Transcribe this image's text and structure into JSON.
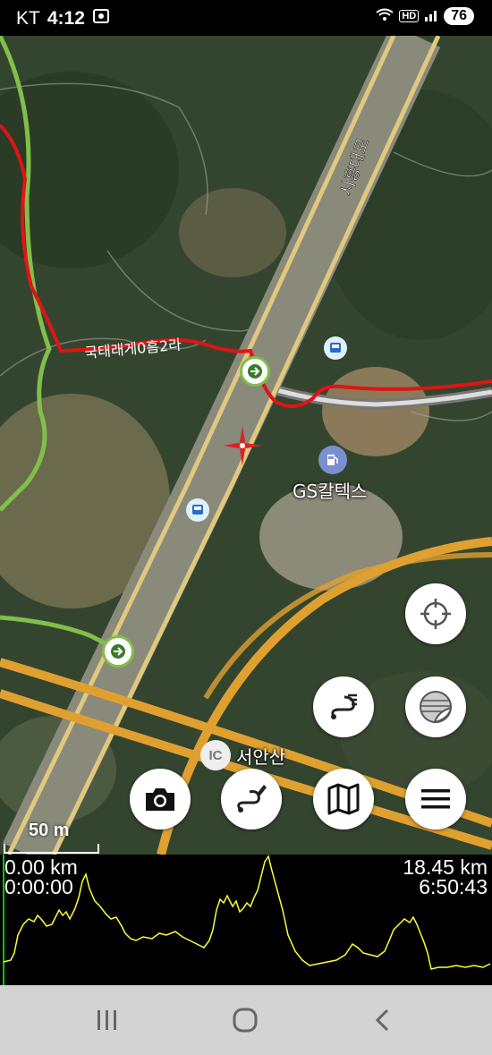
{
  "status_bar": {
    "carrier": "KT",
    "time": "4:12",
    "network_badge": "HD",
    "battery": "76"
  },
  "map": {
    "road_name": "시흥대로",
    "trail_label": "국태래게0흠2라",
    "gas_station_label": "GS칼텍스",
    "interchange_badge": "IC",
    "interchange_label": "서안산",
    "scale_label": "50 m"
  },
  "buttons": {
    "locate": "crosshair-icon",
    "layers": "layers-icon",
    "route_list": "route-list-icon",
    "camera": "camera-icon",
    "draw_route": "draw-route-icon",
    "map": "map-icon",
    "menu": "menu-icon"
  },
  "elevation_profile": {
    "start_distance": "0.00 km",
    "start_time": "0:00:00",
    "end_distance": "18.45 km",
    "end_time": "6:50:43",
    "line_color": "#ffff33"
  },
  "colors": {
    "track": "#e01414",
    "trail": "#7fbf4a",
    "highway": "#e0a030"
  }
}
